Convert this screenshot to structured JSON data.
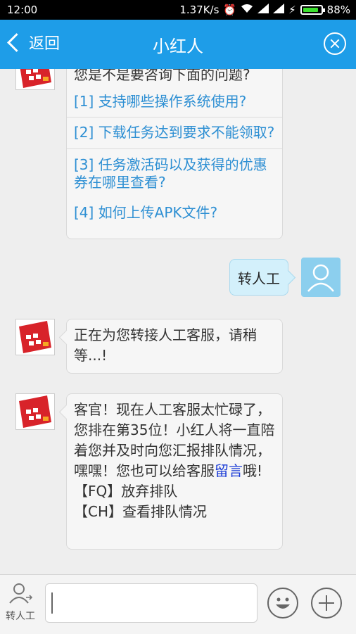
{
  "status_bar": {
    "time": "12:00",
    "network_speed": "1.37K/s",
    "battery_percent": "88%"
  },
  "header": {
    "back_label": "返回",
    "title": "小红人"
  },
  "messages": {
    "question_prompt": "您是不是要咨询下面的问题?",
    "questions": [
      "[1] 支持哪些操作系统使用?",
      "[2] 下载任务达到要求不能领取?",
      "[3] 任务激活码以及获得的优惠券在哪里查看?",
      "[4] 如何上传APK文件?"
    ],
    "user_message": "转人工",
    "bot_transfer": "正在为您转接人工客服，请稍等...!",
    "bot_queue_part1": "客官！现在人工客服太忙碌了，您排在第35位！小红人将一直陪着您并及时向您汇报排队情况，嘿嘿！您也可以给客服",
    "bot_queue_link": "留言",
    "bot_queue_part2": "哦!",
    "option_fq": "【FQ】放弃排队",
    "option_ch": "【CH】查看排队情况"
  },
  "input_bar": {
    "human_label": "转人工"
  },
  "colors": {
    "header_bg": "#1e9de8",
    "link": "#2d8fd3"
  }
}
